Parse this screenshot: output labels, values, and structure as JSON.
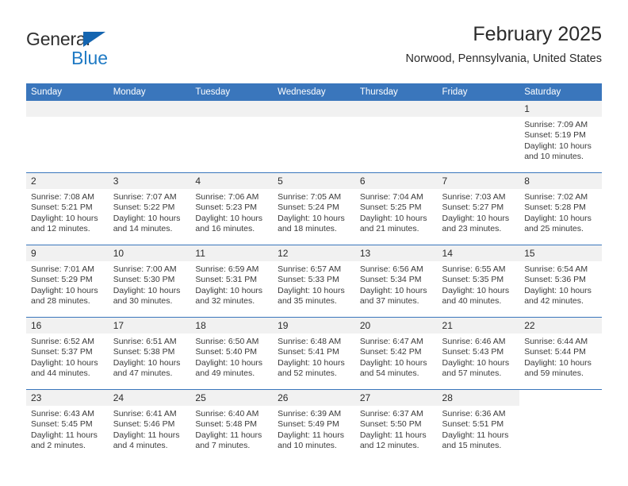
{
  "brand": {
    "name_top": "General",
    "name_bottom": "Blue",
    "accent_color": "#1f7ac4",
    "triangle_color": "#1565b0"
  },
  "header": {
    "title": "February 2025",
    "subtitle": "Norwood, Pennsylvania, United States",
    "header_bg": "#3a76bc",
    "daynum_bg": "#f1f1f1"
  },
  "calendar": {
    "weekday_headers": [
      "Sunday",
      "Monday",
      "Tuesday",
      "Wednesday",
      "Thursday",
      "Friday",
      "Saturday"
    ],
    "weeks": [
      [
        {
          "day": "",
          "empty": true
        },
        {
          "day": "",
          "empty": true
        },
        {
          "day": "",
          "empty": true
        },
        {
          "day": "",
          "empty": true
        },
        {
          "day": "",
          "empty": true
        },
        {
          "day": "",
          "empty": true
        },
        {
          "day": "1",
          "sunrise": "Sunrise: 7:09 AM",
          "sunset": "Sunset: 5:19 PM",
          "daylight1": "Daylight: 10 hours",
          "daylight2": "and 10 minutes."
        }
      ],
      [
        {
          "day": "2",
          "sunrise": "Sunrise: 7:08 AM",
          "sunset": "Sunset: 5:21 PM",
          "daylight1": "Daylight: 10 hours",
          "daylight2": "and 12 minutes."
        },
        {
          "day": "3",
          "sunrise": "Sunrise: 7:07 AM",
          "sunset": "Sunset: 5:22 PM",
          "daylight1": "Daylight: 10 hours",
          "daylight2": "and 14 minutes."
        },
        {
          "day": "4",
          "sunrise": "Sunrise: 7:06 AM",
          "sunset": "Sunset: 5:23 PM",
          "daylight1": "Daylight: 10 hours",
          "daylight2": "and 16 minutes."
        },
        {
          "day": "5",
          "sunrise": "Sunrise: 7:05 AM",
          "sunset": "Sunset: 5:24 PM",
          "daylight1": "Daylight: 10 hours",
          "daylight2": "and 18 minutes."
        },
        {
          "day": "6",
          "sunrise": "Sunrise: 7:04 AM",
          "sunset": "Sunset: 5:25 PM",
          "daylight1": "Daylight: 10 hours",
          "daylight2": "and 21 minutes."
        },
        {
          "day": "7",
          "sunrise": "Sunrise: 7:03 AM",
          "sunset": "Sunset: 5:27 PM",
          "daylight1": "Daylight: 10 hours",
          "daylight2": "and 23 minutes."
        },
        {
          "day": "8",
          "sunrise": "Sunrise: 7:02 AM",
          "sunset": "Sunset: 5:28 PM",
          "daylight1": "Daylight: 10 hours",
          "daylight2": "and 25 minutes."
        }
      ],
      [
        {
          "day": "9",
          "sunrise": "Sunrise: 7:01 AM",
          "sunset": "Sunset: 5:29 PM",
          "daylight1": "Daylight: 10 hours",
          "daylight2": "and 28 minutes."
        },
        {
          "day": "10",
          "sunrise": "Sunrise: 7:00 AM",
          "sunset": "Sunset: 5:30 PM",
          "daylight1": "Daylight: 10 hours",
          "daylight2": "and 30 minutes."
        },
        {
          "day": "11",
          "sunrise": "Sunrise: 6:59 AM",
          "sunset": "Sunset: 5:31 PM",
          "daylight1": "Daylight: 10 hours",
          "daylight2": "and 32 minutes."
        },
        {
          "day": "12",
          "sunrise": "Sunrise: 6:57 AM",
          "sunset": "Sunset: 5:33 PM",
          "daylight1": "Daylight: 10 hours",
          "daylight2": "and 35 minutes."
        },
        {
          "day": "13",
          "sunrise": "Sunrise: 6:56 AM",
          "sunset": "Sunset: 5:34 PM",
          "daylight1": "Daylight: 10 hours",
          "daylight2": "and 37 minutes."
        },
        {
          "day": "14",
          "sunrise": "Sunrise: 6:55 AM",
          "sunset": "Sunset: 5:35 PM",
          "daylight1": "Daylight: 10 hours",
          "daylight2": "and 40 minutes."
        },
        {
          "day": "15",
          "sunrise": "Sunrise: 6:54 AM",
          "sunset": "Sunset: 5:36 PM",
          "daylight1": "Daylight: 10 hours",
          "daylight2": "and 42 minutes."
        }
      ],
      [
        {
          "day": "16",
          "sunrise": "Sunrise: 6:52 AM",
          "sunset": "Sunset: 5:37 PM",
          "daylight1": "Daylight: 10 hours",
          "daylight2": "and 44 minutes."
        },
        {
          "day": "17",
          "sunrise": "Sunrise: 6:51 AM",
          "sunset": "Sunset: 5:38 PM",
          "daylight1": "Daylight: 10 hours",
          "daylight2": "and 47 minutes."
        },
        {
          "day": "18",
          "sunrise": "Sunrise: 6:50 AM",
          "sunset": "Sunset: 5:40 PM",
          "daylight1": "Daylight: 10 hours",
          "daylight2": "and 49 minutes."
        },
        {
          "day": "19",
          "sunrise": "Sunrise: 6:48 AM",
          "sunset": "Sunset: 5:41 PM",
          "daylight1": "Daylight: 10 hours",
          "daylight2": "and 52 minutes."
        },
        {
          "day": "20",
          "sunrise": "Sunrise: 6:47 AM",
          "sunset": "Sunset: 5:42 PM",
          "daylight1": "Daylight: 10 hours",
          "daylight2": "and 54 minutes."
        },
        {
          "day": "21",
          "sunrise": "Sunrise: 6:46 AM",
          "sunset": "Sunset: 5:43 PM",
          "daylight1": "Daylight: 10 hours",
          "daylight2": "and 57 minutes."
        },
        {
          "day": "22",
          "sunrise": "Sunrise: 6:44 AM",
          "sunset": "Sunset: 5:44 PM",
          "daylight1": "Daylight: 10 hours",
          "daylight2": "and 59 minutes."
        }
      ],
      [
        {
          "day": "23",
          "sunrise": "Sunrise: 6:43 AM",
          "sunset": "Sunset: 5:45 PM",
          "daylight1": "Daylight: 11 hours",
          "daylight2": "and 2 minutes."
        },
        {
          "day": "24",
          "sunrise": "Sunrise: 6:41 AM",
          "sunset": "Sunset: 5:46 PM",
          "daylight1": "Daylight: 11 hours",
          "daylight2": "and 4 minutes."
        },
        {
          "day": "25",
          "sunrise": "Sunrise: 6:40 AM",
          "sunset": "Sunset: 5:48 PM",
          "daylight1": "Daylight: 11 hours",
          "daylight2": "and 7 minutes."
        },
        {
          "day": "26",
          "sunrise": "Sunrise: 6:39 AM",
          "sunset": "Sunset: 5:49 PM",
          "daylight1": "Daylight: 11 hours",
          "daylight2": "and 10 minutes."
        },
        {
          "day": "27",
          "sunrise": "Sunrise: 6:37 AM",
          "sunset": "Sunset: 5:50 PM",
          "daylight1": "Daylight: 11 hours",
          "daylight2": "and 12 minutes."
        },
        {
          "day": "28",
          "sunrise": "Sunrise: 6:36 AM",
          "sunset": "Sunset: 5:51 PM",
          "daylight1": "Daylight: 11 hours",
          "daylight2": "and 15 minutes."
        },
        {
          "day": "",
          "empty": true,
          "blank": true
        }
      ]
    ]
  }
}
